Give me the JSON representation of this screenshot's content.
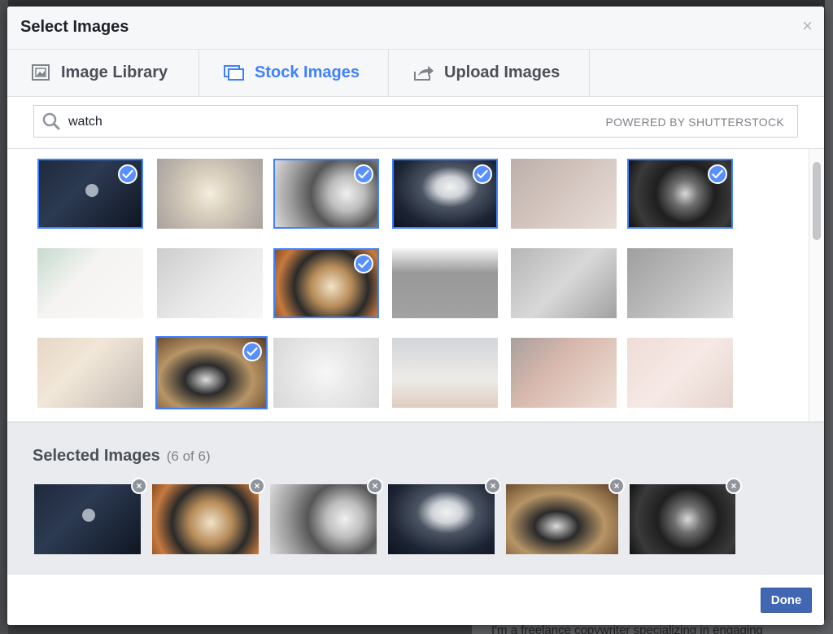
{
  "dialog": {
    "title": "Select Images",
    "close_glyph": "×"
  },
  "tabs": [
    {
      "label": "Image Library",
      "icon": "image-library-icon",
      "active": false
    },
    {
      "label": "Stock Images",
      "icon": "stock-images-icon",
      "active": true
    },
    {
      "label": "Upload Images",
      "icon": "upload-icon",
      "active": false
    }
  ],
  "search": {
    "value": "watch",
    "powered_by": "POWERED BY SHUTTERSTOCK"
  },
  "grid": [
    [
      {
        "subject": "watch-on-suit-wrist",
        "selected": true
      },
      {
        "subject": "watch-gears-repair",
        "selected": false
      },
      {
        "subject": "chronograph-closeup",
        "selected": true
      },
      {
        "subject": "steel-watch-dark",
        "selected": true
      },
      {
        "subject": "wrist-watch-sweater",
        "selected": false
      },
      {
        "subject": "dark-chronograph",
        "selected": true
      }
    ],
    [
      {
        "subject": "flatlay-accessories",
        "selected": false
      },
      {
        "subject": "arm-checking-watch",
        "selected": false
      },
      {
        "subject": "skeleton-watch-gold",
        "selected": true
      },
      {
        "subject": "tuxedo-watch",
        "selected": false
      },
      {
        "subject": "watchmaker-repair",
        "selected": false
      },
      {
        "subject": "crossed-arms-watch",
        "selected": false
      }
    ],
    [
      {
        "subject": "camera-and-watch",
        "selected": false
      },
      {
        "subject": "stacked-watches",
        "selected": true
      },
      {
        "subject": "skeleton-mechanism",
        "selected": false
      },
      {
        "subject": "smartwatch-sweater",
        "selected": false
      },
      {
        "subject": "woman-checking-watch",
        "selected": false
      },
      {
        "subject": "blurry-wrist-watch",
        "selected": false
      }
    ]
  ],
  "selected_panel": {
    "title": "Selected Images",
    "count": "(6 of 6)",
    "remove_glyph": "×",
    "items": [
      {
        "subject": "watch-on-suit-wrist"
      },
      {
        "subject": "skeleton-watch-gold"
      },
      {
        "subject": "chronograph-closeup"
      },
      {
        "subject": "steel-watch-dark"
      },
      {
        "subject": "stacked-watches"
      },
      {
        "subject": "dark-chronograph"
      }
    ]
  },
  "footer": {
    "done_label": "Done"
  },
  "background_page": {
    "bottom_text": "I'm a freelance copywriter specializing in engaging"
  },
  "colors": {
    "accent": "#4080ff",
    "done_button": "#4267b2",
    "panel_bg": "#e9ebee"
  }
}
